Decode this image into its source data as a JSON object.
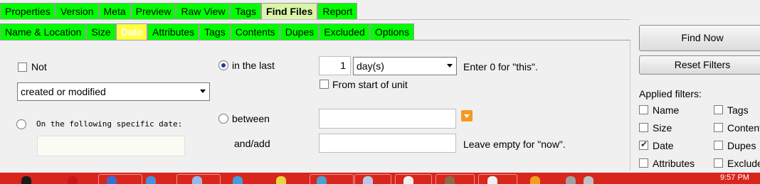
{
  "top_tabs": [
    "Properties",
    "Version",
    "Meta",
    "Preview",
    "Raw View",
    "Tags",
    "Find Files",
    "Report"
  ],
  "sub_tabs": [
    "Name & Location",
    "Size",
    "Date",
    "Attributes",
    "Tags",
    "Contents",
    "Dupes",
    "Excluded",
    "Options"
  ],
  "left": {
    "not_label": "Not",
    "date_type_selected": "created or modified",
    "specific_date_label": "On the following specific date:",
    "specific_date_value": ""
  },
  "middle": {
    "in_the_last_label": "in the last",
    "between_label": "between",
    "and_add_label": "and/add"
  },
  "right_fields": {
    "count_value": "1",
    "unit_selected": "day(s)",
    "hint_this": "Enter 0 for \"this\".",
    "from_start_label": "From start of unit",
    "hint_now": "Leave empty for \"now\"."
  },
  "buttons": {
    "find_now": "Find Now",
    "reset_filters": "Reset Filters"
  },
  "applied_filters": {
    "title": "Applied filters:",
    "items": [
      {
        "label": "Name",
        "checked": false
      },
      {
        "label": "Tags",
        "checked": false
      },
      {
        "label": "Size",
        "checked": false
      },
      {
        "label": "Contents",
        "checked": false
      },
      {
        "label": "Date",
        "checked": true
      },
      {
        "label": "Dupes",
        "checked": false
      },
      {
        "label": "Attributes",
        "checked": false
      },
      {
        "label": "Excluded",
        "checked": false
      }
    ]
  },
  "taskbar": {
    "clock": "9:57 PM"
  },
  "colors": {
    "tab_green": "#00ff00",
    "tab_active": "#d9f5a8",
    "tab_date": "#ffff44",
    "taskbar_red": "#d8261c",
    "orange_button": "#f39a1f"
  }
}
